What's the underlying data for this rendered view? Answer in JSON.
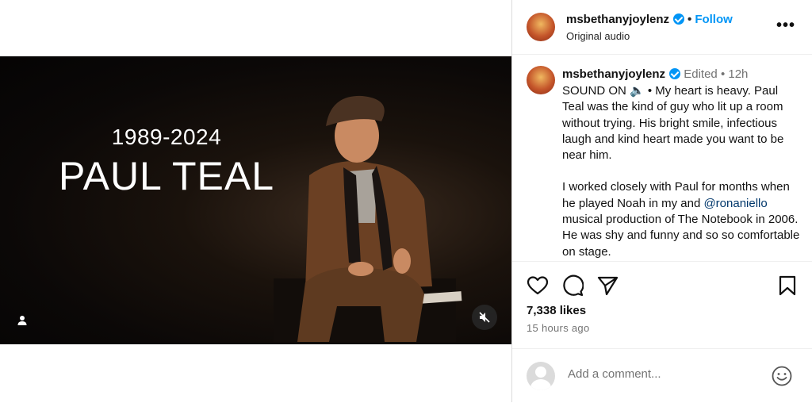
{
  "media": {
    "years_text": "1989-2024",
    "name_text": "PAUL TEAL",
    "user_tag_icon": "person-icon",
    "mute_icon": "speaker-muted-icon"
  },
  "header": {
    "username": "msbethanyjoylenz",
    "separator": "•",
    "follow_label": "Follow",
    "audio_label": "Original audio",
    "more_icon": "more-horizontal-icon",
    "more_label": "•••"
  },
  "caption": {
    "username": "msbethanyjoylenz",
    "edited": "Edited",
    "separator": "•",
    "age": "12h",
    "paragraph1": "SOUND ON 🔈 • My heart is heavy. Paul Teal was the kind of guy who lit up a room without trying. His bright smile, infectious laugh and kind heart made you want to be near him.",
    "p2_before": "I worked closely with Paul for months when he played Noah in my and ",
    "mention": "@ronaniello",
    "p2_after": " musical production of The Notebook in 2006. He was shy and funny and so so comfortable on stage."
  },
  "actions": {
    "like_icon": "heart-icon",
    "comment_icon": "comment-bubble-icon",
    "share_icon": "paper-plane-icon",
    "save_icon": "bookmark-icon",
    "likes_text": "7,338 likes",
    "timestamp": "15 hours ago"
  },
  "comment_box": {
    "placeholder": "Add a comment...",
    "emoji_icon": "smiley-icon"
  },
  "colors": {
    "accent": "#0095f6",
    "muted_text": "#737373",
    "mention": "#00376b"
  }
}
